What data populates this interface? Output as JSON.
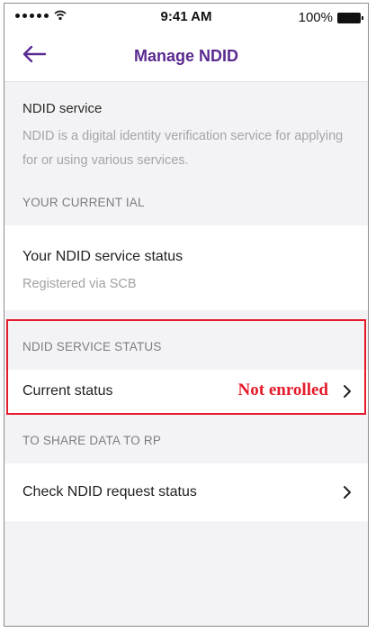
{
  "status_bar": {
    "signal_icon": "signal-dots-icon",
    "wifi_icon": "wifi-icon",
    "time": "9:41 AM",
    "battery_percent": "100%",
    "battery_icon": "battery-icon"
  },
  "nav": {
    "back_icon": "arrow-left-icon",
    "title": "Manage NDID",
    "accent_color": "#5a2a91"
  },
  "intro": {
    "heading": "NDID service",
    "description": "NDID is a digital identity verification service for applying for or using various services."
  },
  "sections": {
    "current_ial_label": "YOUR CURRENT IAL",
    "service_status_label": "NDID SERVICE STATUS",
    "share_data_label": "TO SHARE DATA TO RP"
  },
  "ial_card": {
    "title": "Your NDID service status",
    "subtitle": "Registered via SCB"
  },
  "status_row": {
    "label": "Current status",
    "value": "Not enrolled",
    "value_color": "#e51b2b",
    "chevron_icon": "chevron-right-icon"
  },
  "request_row": {
    "label": "Check NDID request status",
    "chevron_icon": "chevron-right-icon"
  }
}
